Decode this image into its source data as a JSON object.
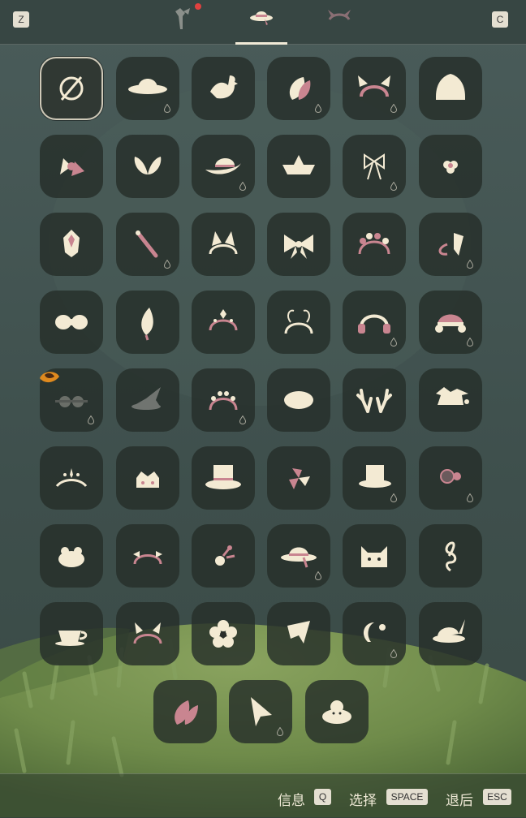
{
  "top_bar": {
    "left_key": "Z",
    "right_key": "C",
    "tabs": [
      {
        "id": "tab-accessories",
        "icon": "cane-accessory-icon",
        "has_notification": true
      },
      {
        "id": "tab-hats",
        "icon": "hat-category-icon",
        "active": true
      },
      {
        "id": "tab-horns",
        "icon": "horns-category-icon"
      }
    ]
  },
  "items": [
    {
      "icon": "none-icon",
      "selected": true
    },
    {
      "icon": "sun-hat-icon",
      "candle": true
    },
    {
      "icon": "bird-icon"
    },
    {
      "icon": "leaf-icon",
      "candle": true
    },
    {
      "icon": "ear-headband-icon",
      "candle": true
    },
    {
      "icon": "beanie-icon"
    },
    {
      "icon": "flower-bow-icon"
    },
    {
      "icon": "butterfly-bow-icon"
    },
    {
      "icon": "cowboy-hat-icon",
      "candle": true
    },
    {
      "icon": "paper-boat-hat-icon"
    },
    {
      "icon": "ribbon-bow-icon",
      "candle": true
    },
    {
      "icon": "small-flower-icon"
    },
    {
      "icon": "crystal-clip-icon"
    },
    {
      "icon": "hair-stick-icon",
      "candle": true
    },
    {
      "icon": "fox-ears-icon"
    },
    {
      "icon": "large-bow-icon"
    },
    {
      "icon": "flower-crown-icon"
    },
    {
      "icon": "hook-ribbon-icon",
      "candle": true
    },
    {
      "icon": "small-bow-icon"
    },
    {
      "icon": "feather-icon"
    },
    {
      "icon": "jeweled-circlet-icon"
    },
    {
      "icon": "antenna-headband-icon"
    },
    {
      "icon": "headphones-icon",
      "candle": true
    },
    {
      "icon": "earmuff-bonnet-icon",
      "candle": true
    },
    {
      "icon": "goggles-icon",
      "candle": true,
      "badge": true
    },
    {
      "icon": "witch-hat-icon"
    },
    {
      "icon": "bead-circlet-icon",
      "candle": true
    },
    {
      "icon": "beret-icon"
    },
    {
      "icon": "antlers-icon"
    },
    {
      "icon": "jester-hat-icon"
    },
    {
      "icon": "tiara-icon"
    },
    {
      "icon": "crown-cake-icon"
    },
    {
      "icon": "top-hat-card-icon"
    },
    {
      "icon": "petal-clip-icon"
    },
    {
      "icon": "top-hat-icon",
      "candle": true
    },
    {
      "icon": "disco-flower-clip-icon",
      "candle": true
    },
    {
      "icon": "frog-hat-icon"
    },
    {
      "icon": "bow-headband-icon"
    },
    {
      "icon": "rose-sprig-icon"
    },
    {
      "icon": "ribbon-sun-hat-icon",
      "candle": true
    },
    {
      "icon": "cat-face-icon"
    },
    {
      "icon": "treble-clef-icon"
    },
    {
      "icon": "teacup-icon"
    },
    {
      "icon": "bunny-headband-icon"
    },
    {
      "icon": "flower-icon"
    },
    {
      "icon": "paper-arrow-icon"
    },
    {
      "icon": "moon-star-clip-icon",
      "candle": true
    },
    {
      "icon": "feather-brim-hat-icon"
    },
    {
      "icon": "petal-icon"
    },
    {
      "icon": "cursor-icon",
      "candle": true
    },
    {
      "icon": "bun-hat-icon"
    }
  ],
  "bottom_bar": {
    "info_label": "信息",
    "info_key": "Q",
    "select_label": "选择",
    "select_key": "SPACE",
    "back_label": "退后",
    "back_key": "ESC"
  },
  "colors": {
    "icon_cream": "#f3ead3",
    "icon_pink": "#c98590",
    "tile_bg": "#262e2a",
    "bg_grass": "#6f8b4a",
    "bg_stone": "#3f4e4b",
    "notification": "#e0413f"
  }
}
